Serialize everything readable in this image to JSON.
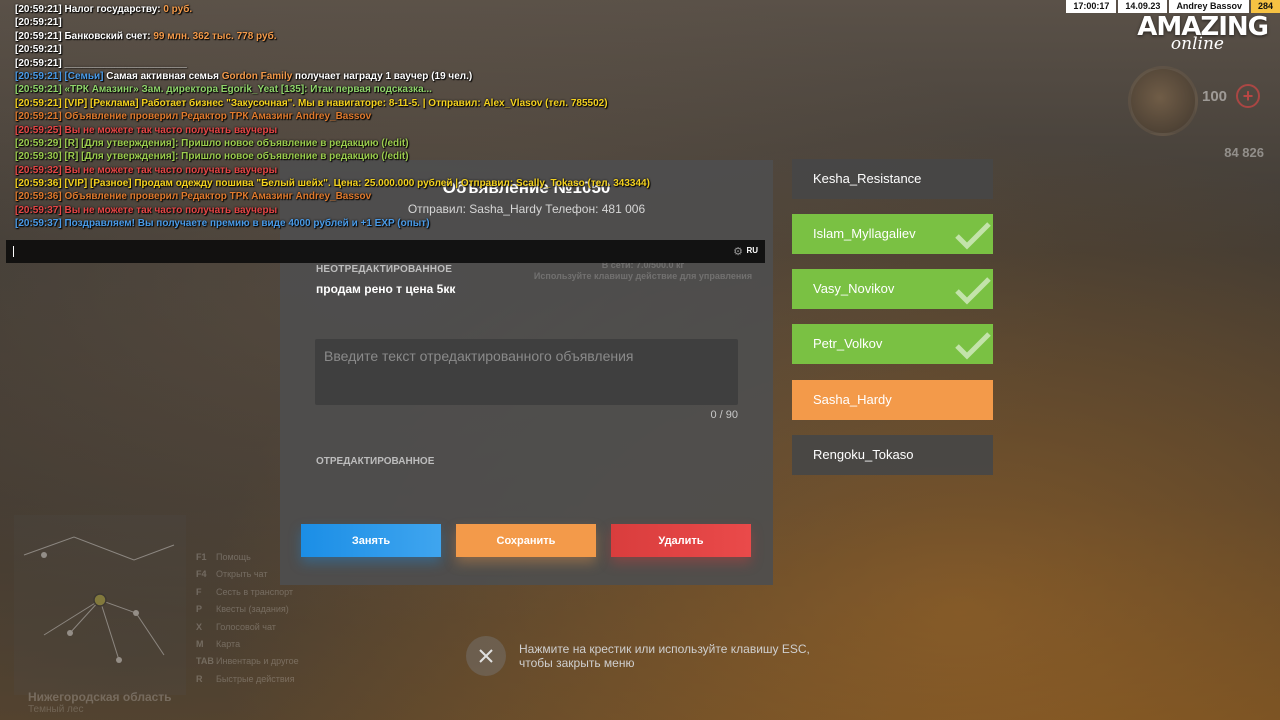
{
  "status_bar": {
    "time": "17:00:17",
    "date": "14.09.23",
    "player": "Andrey Bassov",
    "level": "284"
  },
  "brand": {
    "main": "AMAZING",
    "sub": "online"
  },
  "hud": {
    "health": "100",
    "plus": "+",
    "money": "84 826"
  },
  "chat": {
    "lines": [
      [
        {
          "t": "[20:59:21] Налог государству: ",
          "c": "#ffffff"
        },
        {
          "t": "0 руб.",
          "c": "#f39a4a"
        }
      ],
      [
        {
          "t": "[20:59:21]",
          "c": "#ffffff"
        }
      ],
      [
        {
          "t": "[20:59:21] Банковский счет: ",
          "c": "#ffffff"
        },
        {
          "t": "99 млн. 362 тыс. 778 руб.",
          "c": "#f39a4a"
        }
      ],
      [
        {
          "t": "[20:59:21]",
          "c": "#ffffff"
        }
      ],
      [
        {
          "t": "[20:59:21] ______________________",
          "c": "#ffffff"
        }
      ],
      [
        {
          "t": "[20:59:21] [Семьи] ",
          "c": "#4a9be8"
        },
        {
          "t": "Самая активная семья ",
          "c": "#ffffff"
        },
        {
          "t": "Gordon Family",
          "c": "#f39a4a"
        },
        {
          "t": " получает награду 1 ваучер (19 чел.)",
          "c": "#ffffff"
        }
      ],
      [
        {
          "t": "[20:59:21] «ТРК Амазинг» Зам. директора Egorik_Yeat [135]: Итак первая подсказка...",
          "c": "#8fd46a"
        }
      ],
      [
        {
          "t": "[20:59:21] [VIP] [Реклама] Работает бизнес \"Закусочная\". Мы в навигаторе: 8-11-5. | Отправил: Alex_Vlasov (тел. 785502)",
          "c": "#f4d21f"
        }
      ],
      [
        {
          "t": "[20:59:21] Объявление проверил Редактор ТРК Амазинг Andrey_Bassov",
          "c": "#e07b2e"
        }
      ],
      [
        {
          "t": "[20:59:25] Вы не можете так часто получать ваучеры",
          "c": "#e64646"
        }
      ],
      [
        {
          "t": "[20:59:29] [R] [Для утверждения]: Пришло новое объявление в редакцию (/edit)",
          "c": "#9ccd4e"
        }
      ],
      [
        {
          "t": "[20:59:30] [R] [Для утверждения]: Пришло новое объявление в редакцию (/edit)",
          "c": "#9ccd4e"
        }
      ],
      [
        {
          "t": "[20:59:32] Вы не можете так часто получать ваучеры",
          "c": "#e64646"
        }
      ],
      [
        {
          "t": "[20:59:36] [VIP] [Разное] Продам одежду пошива \"Белый шейх\". Цена: 25.000.000 рублей | Отправил: Scally_Tokaso (тел. 343344)",
          "c": "#f4d21f"
        }
      ],
      [
        {
          "t": "[20:59:36] Объявление проверил Редактор ТРК Амазинг Andrey_Bassov",
          "c": "#e07b2e"
        }
      ],
      [
        {
          "t": "[20:59:37] Вы не можете так часто получать ваучеры",
          "c": "#e64646"
        }
      ],
      [
        {
          "t": "[20:59:37] Поздравляем! Вы получаете премию в виде 4000 рублей и +1 EXP (опыт)",
          "c": "#4a9be8"
        }
      ]
    ],
    "input_value": "",
    "lang": "RU"
  },
  "panel": {
    "title": "Объявление №1050",
    "sender": "Отправил: Sasha_Hardy Телефон: 481 006",
    "unedited_label": "НЕОТРЕДАКТИРОВАННОЕ",
    "unedited_text": "продам рено т цена 5кк",
    "edit_placeholder": "Введите текст отредактированного объявления",
    "counter": "0 / 90",
    "edited_label": "ОТРЕДАКТИРОВАННОЕ",
    "status_line1": "В сети: 7.0/500.0 кг",
    "status_line2": "Используйте клавишу действие для управления",
    "buttons": {
      "take": "Занять",
      "save": "Сохранить",
      "delete": "Удалить"
    }
  },
  "editors": [
    {
      "name": "Kesha_Resistance",
      "state": "dark",
      "checked": false
    },
    {
      "name": "Islam_Myllagaliev",
      "state": "green",
      "checked": true
    },
    {
      "name": "Vasy_Novikov",
      "state": "green",
      "checked": true
    },
    {
      "name": "Petr_Volkov",
      "state": "green",
      "checked": true
    },
    {
      "name": "Sasha_Hardy",
      "state": "orange",
      "checked": false
    },
    {
      "name": "Rengoku_Tokaso",
      "state": "dark",
      "checked": false
    }
  ],
  "close_hint": {
    "line1": "Нажмите на крестик или используйте клавишу ESC,",
    "line2": "чтобы закрыть меню"
  },
  "hotkeys": [
    {
      "key": "F1",
      "label": "Помощь"
    },
    {
      "key": "F4",
      "label": "Открыть чат"
    },
    {
      "key": "F",
      "label": "Сесть в транспорт"
    },
    {
      "key": "P",
      "label": "Квесты (задания)"
    },
    {
      "key": "X",
      "label": "Голосовой чат"
    },
    {
      "key": "M",
      "label": "Карта"
    },
    {
      "key": "TAB",
      "label": "Инвентарь и другое"
    },
    {
      "key": "R",
      "label": "Быстрые действия"
    }
  ],
  "minimap": {
    "region": "Нижегородская область",
    "subregion": "Темный лес"
  },
  "colors": {
    "take": "#1b8ee6",
    "save": "#f39a4a",
    "delete": "#d93d3d",
    "editor_green": "#7ac143",
    "editor_orange": "#f39a4a"
  }
}
